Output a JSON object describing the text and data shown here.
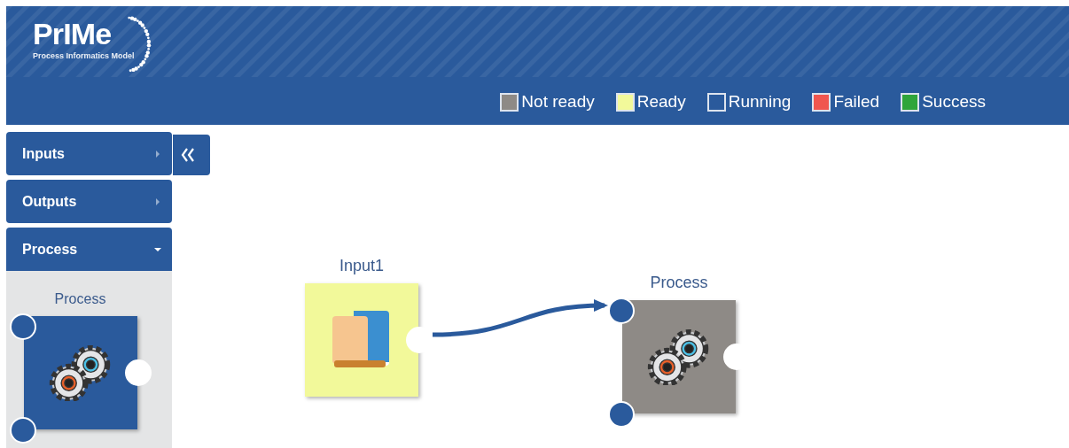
{
  "logo": {
    "title": "PrIMe",
    "subtitle": "Process Informatics Model"
  },
  "legend": [
    {
      "label": "Not ready",
      "color": "#8e8a86"
    },
    {
      "label": "Ready",
      "color": "#f2f99a"
    },
    {
      "label": "Running",
      "color": "#2a5a9c"
    },
    {
      "label": "Failed",
      "color": "#f0564f"
    },
    {
      "label": "Success",
      "color": "#2fa53a"
    }
  ],
  "sidebar": {
    "items": [
      {
        "label": "Inputs",
        "expanded": false
      },
      {
        "label": "Outputs",
        "expanded": false
      },
      {
        "label": "Process",
        "expanded": true,
        "palette": [
          {
            "label": "Process",
            "kind": "process"
          }
        ]
      }
    ]
  },
  "canvas": {
    "nodes": [
      {
        "label": "Input1",
        "kind": "input",
        "color": "#f2f99a"
      },
      {
        "label": "Process",
        "kind": "process",
        "color": "#8e8a86"
      }
    ],
    "connections": [
      {
        "kind": "arrow"
      }
    ]
  }
}
